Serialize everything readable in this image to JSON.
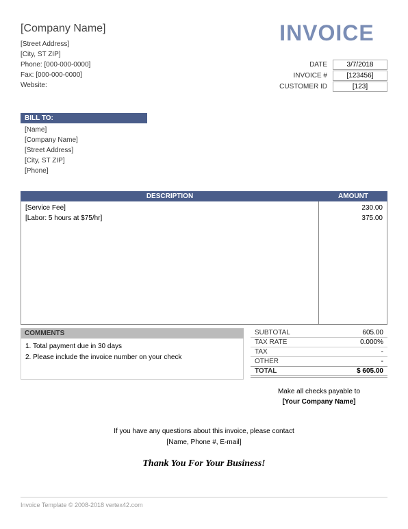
{
  "company": {
    "name": "[Company Name]",
    "street": "[Street Address]",
    "citystzip": "[City, ST  ZIP]",
    "phone_label": "Phone: [000-000-0000]",
    "fax_label": "Fax: [000-000-0000]",
    "website_label": "Website:"
  },
  "invoice_title": "INVOICE",
  "meta": {
    "date_label": "DATE",
    "date_value": "3/7/2018",
    "invoice_num_label": "INVOICE #",
    "invoice_num_value": "[123456]",
    "customer_id_label": "CUSTOMER ID",
    "customer_id_value": "[123]"
  },
  "bill_to": {
    "header": "BILL TO:",
    "name": "[Name]",
    "company": "[Company Name]",
    "street": "[Street Address]",
    "citystzip": "[City, ST  ZIP]",
    "phone": "[Phone]"
  },
  "columns": {
    "description": "DESCRIPTION",
    "amount": "AMOUNT"
  },
  "items": [
    {
      "description": "[Service Fee]",
      "amount": "230.00"
    },
    {
      "description": "[Labor: 5 hours at $75/hr]",
      "amount": "375.00"
    }
  ],
  "comments": {
    "header": "COMMENTS",
    "lines": [
      "1. Total payment due in 30 days",
      "2. Please include the invoice number on your check"
    ]
  },
  "totals": {
    "subtotal_label": "SUBTOTAL",
    "subtotal_value": "605.00",
    "tax_rate_label": "TAX RATE",
    "tax_rate_value": "0.000%",
    "tax_label": "TAX",
    "tax_value": "-",
    "other_label": "OTHER",
    "other_value": "-",
    "total_label": "TOTAL",
    "total_value": "$         605.00"
  },
  "payable": {
    "line": "Make all checks payable to",
    "name": "[Your Company Name]"
  },
  "contact": {
    "line1": "If you have any questions about this invoice, please contact",
    "line2": "[Name, Phone #, E-mail]"
  },
  "thanks": "Thank You For Your Business!",
  "footer": "Invoice Template © 2008-2018 vertex42.com"
}
